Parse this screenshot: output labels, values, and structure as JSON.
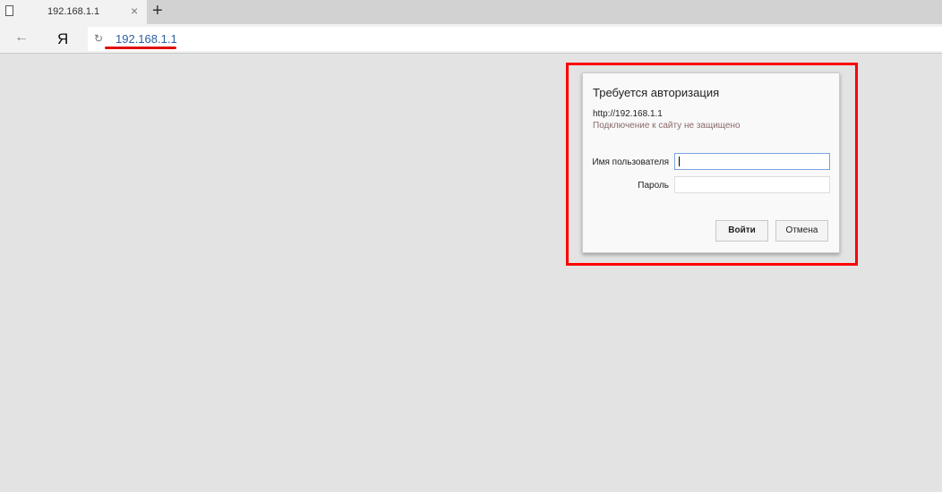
{
  "browser": {
    "tab_title": "192.168.1.1",
    "new_tab_label": "+",
    "close_label": "×",
    "back_label": "←",
    "yandex_label": "Я",
    "reload_label": "↻",
    "address": "192.168.1.1"
  },
  "dialog": {
    "title": "Требуется авторизация",
    "url": "http://192.168.1.1",
    "warning": "Подключение к сайту не защищено",
    "username_label": "Имя пользователя",
    "username_value": "",
    "password_label": "Пароль",
    "password_value": "",
    "login_button": "Войти",
    "cancel_button": "Отмена"
  },
  "colors": {
    "highlight": "#ff0000",
    "page_bg": "#e3e3e3"
  }
}
